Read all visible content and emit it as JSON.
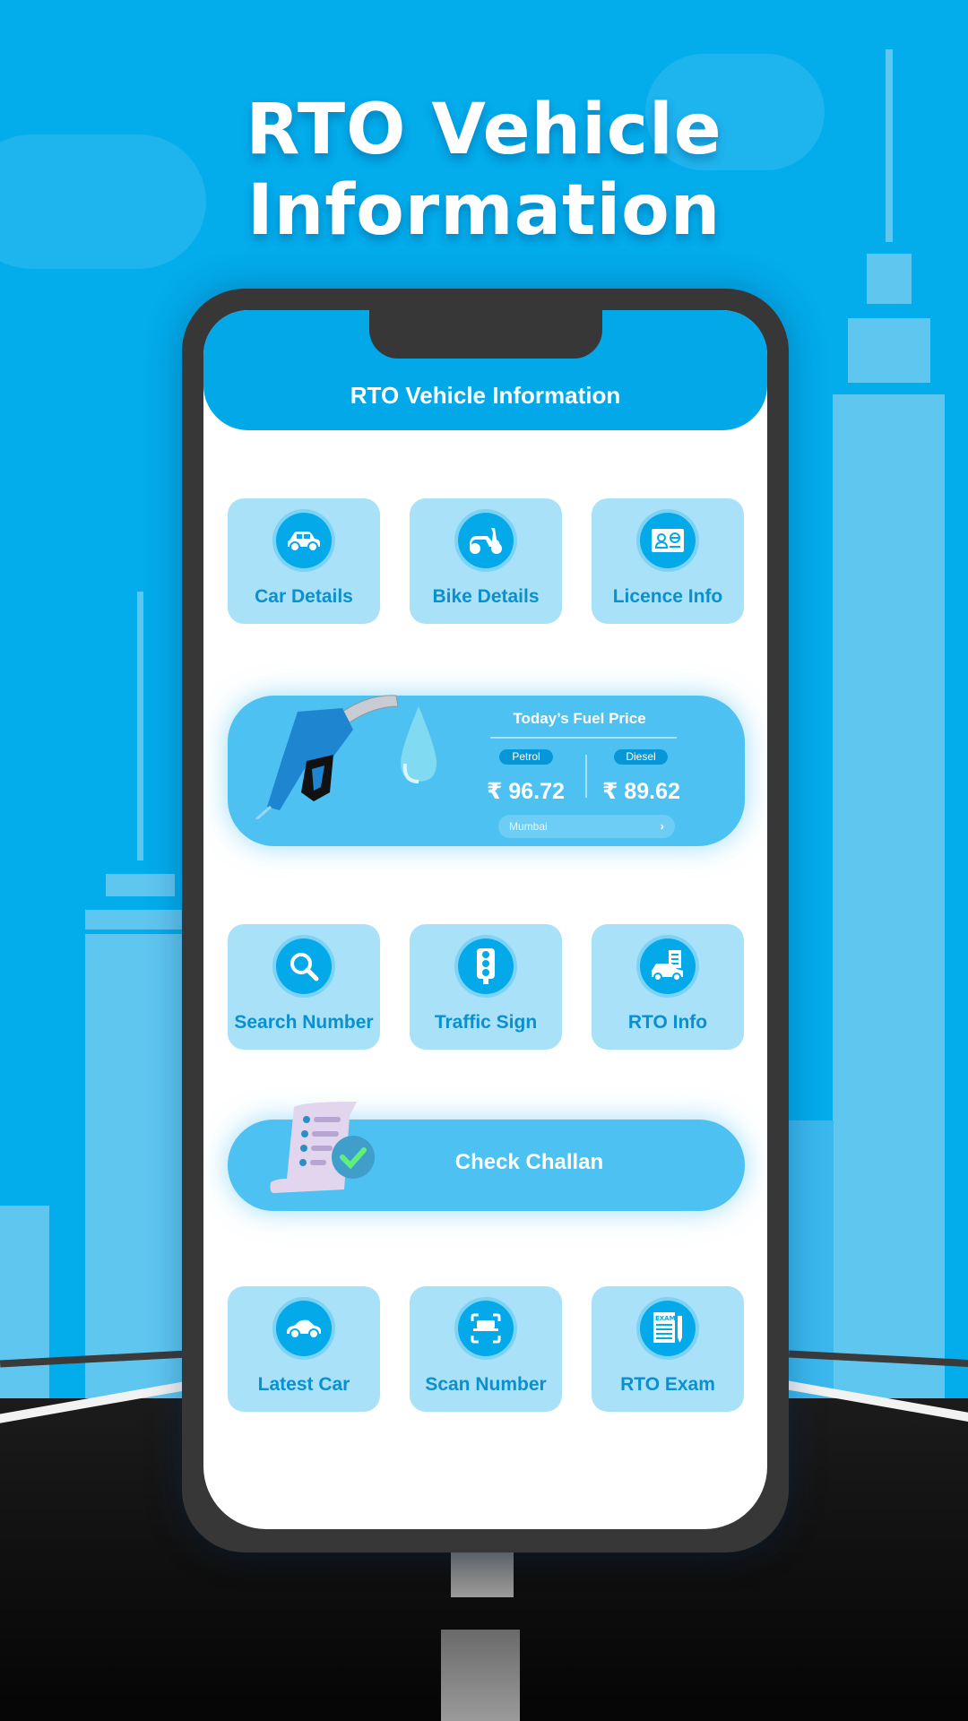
{
  "hero": {
    "title": "RTO Vehicle Information"
  },
  "app": {
    "title": "RTO Vehicle Information",
    "accent": "#03a8e8",
    "tile_bg": "#a9e2f8",
    "tile_text": "#0a8fcf"
  },
  "tiles_row1": [
    {
      "label": "Car Details",
      "icon": "car-icon"
    },
    {
      "label": "Bike Details",
      "icon": "scooter-icon"
    },
    {
      "label": "Licence Info",
      "icon": "licence-card-icon"
    }
  ],
  "fuel": {
    "title": "Today’s Fuel Price",
    "petrol_label": "Petrol",
    "petrol_price": "₹ 96.72",
    "diesel_label": "Diesel",
    "diesel_price": "₹ 89.62",
    "city": "Mumbai",
    "chevron": "›"
  },
  "tiles_row2": [
    {
      "label": "Search Number",
      "icon": "search-icon"
    },
    {
      "label": "Traffic Sign",
      "icon": "traffic-light-icon"
    },
    {
      "label": "RTO Info",
      "icon": "rto-car-document-icon"
    }
  ],
  "challan": {
    "label": "Check Challan",
    "icon": "challan-receipt-check-icon"
  },
  "tiles_row3": [
    {
      "label": "Latest Car",
      "icon": "sedan-car-icon"
    },
    {
      "label": "Scan Number",
      "icon": "scan-plate-icon"
    },
    {
      "label": "RTO Exam",
      "icon": "exam-paper-icon"
    }
  ]
}
